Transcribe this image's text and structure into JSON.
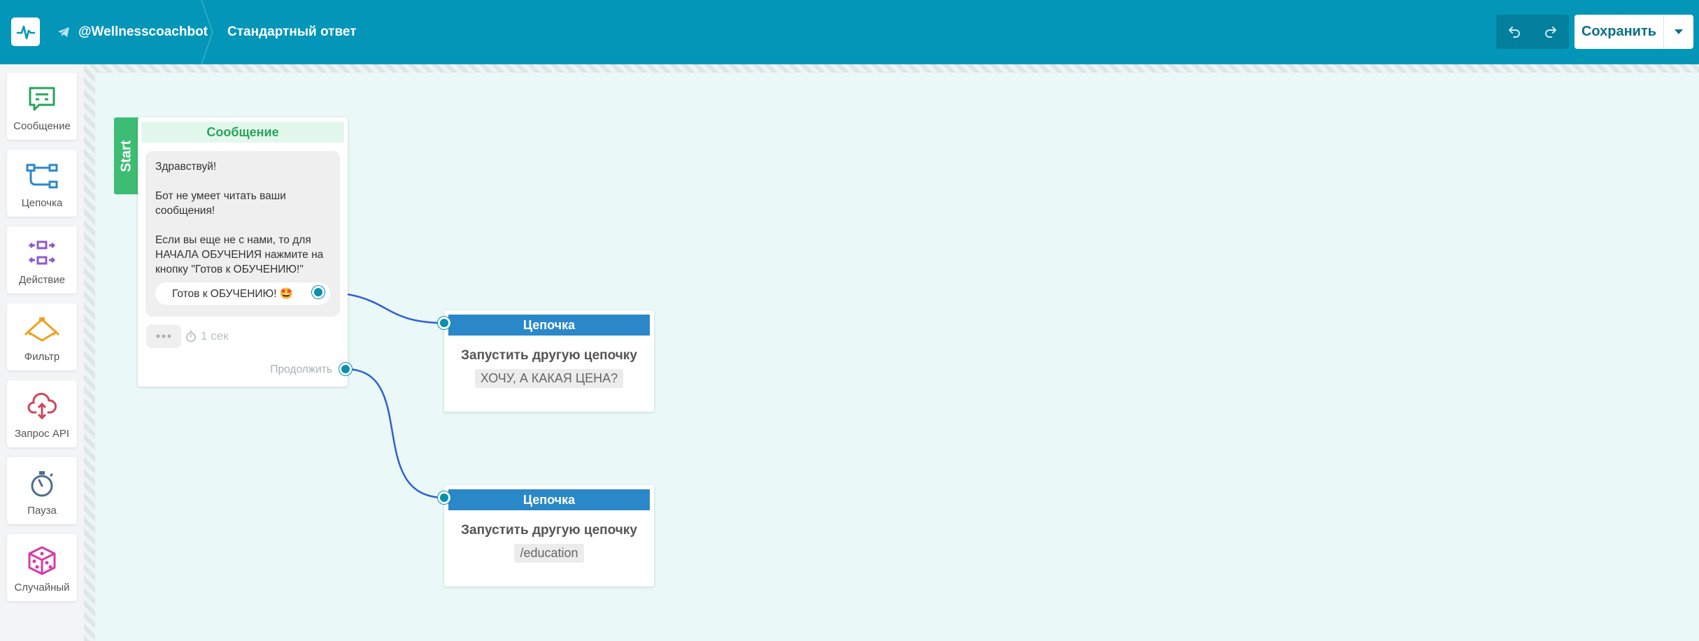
{
  "header": {
    "bot_name": "@Wellnesscoachbot",
    "page_title": "Стандартный ответ",
    "save_label": "Сохранить"
  },
  "sidebar": {
    "items": [
      {
        "label": "Сообщение",
        "icon": "message-icon",
        "color": "#2aa35e"
      },
      {
        "label": "Цепочка",
        "icon": "chain-icon",
        "color": "#2a88c9"
      },
      {
        "label": "Действие",
        "icon": "action-icon",
        "color": "#8f5bc6"
      },
      {
        "label": "Фильтр",
        "icon": "filter-icon",
        "color": "#f0a020"
      },
      {
        "label": "Запрос API",
        "icon": "api-cloud-icon",
        "color": "#d0465a"
      },
      {
        "label": "Пауза",
        "icon": "stopwatch-icon",
        "color": "#4f6e8a"
      },
      {
        "label": "Случайный",
        "icon": "dice-icon",
        "color": "#d83aa8"
      }
    ]
  },
  "message_node": {
    "start_label": "Start",
    "title": "Сообщение",
    "text_lines": [
      "Здравствуй!",
      "Бот не умеет читать ваши сообщения!",
      "Если вы еще не с нами, то для НАЧАЛА ОБУЧЕНИЯ нажмите на кнопку \"Готов к ОБУЧЕНИЮ!\""
    ],
    "button_label": "Готов к ОБУЧЕНИЮ! 🤩",
    "delay": "1 сек",
    "continue_label": "Продолжить"
  },
  "chain_nodes": [
    {
      "title": "Цепочка",
      "description": "Запустить другую цепочку",
      "target": "ХОЧУ, А КАКАЯ ЦЕНА?"
    },
    {
      "title": "Цепочка",
      "description": "Запустить другую цепочку",
      "target": "/education"
    }
  ],
  "colors": {
    "header": "#0396b8",
    "canvas": "#eaf8f8",
    "start": "#3cbd73",
    "chain_title": "#2a88c9",
    "wire": "#2f5fd6"
  }
}
